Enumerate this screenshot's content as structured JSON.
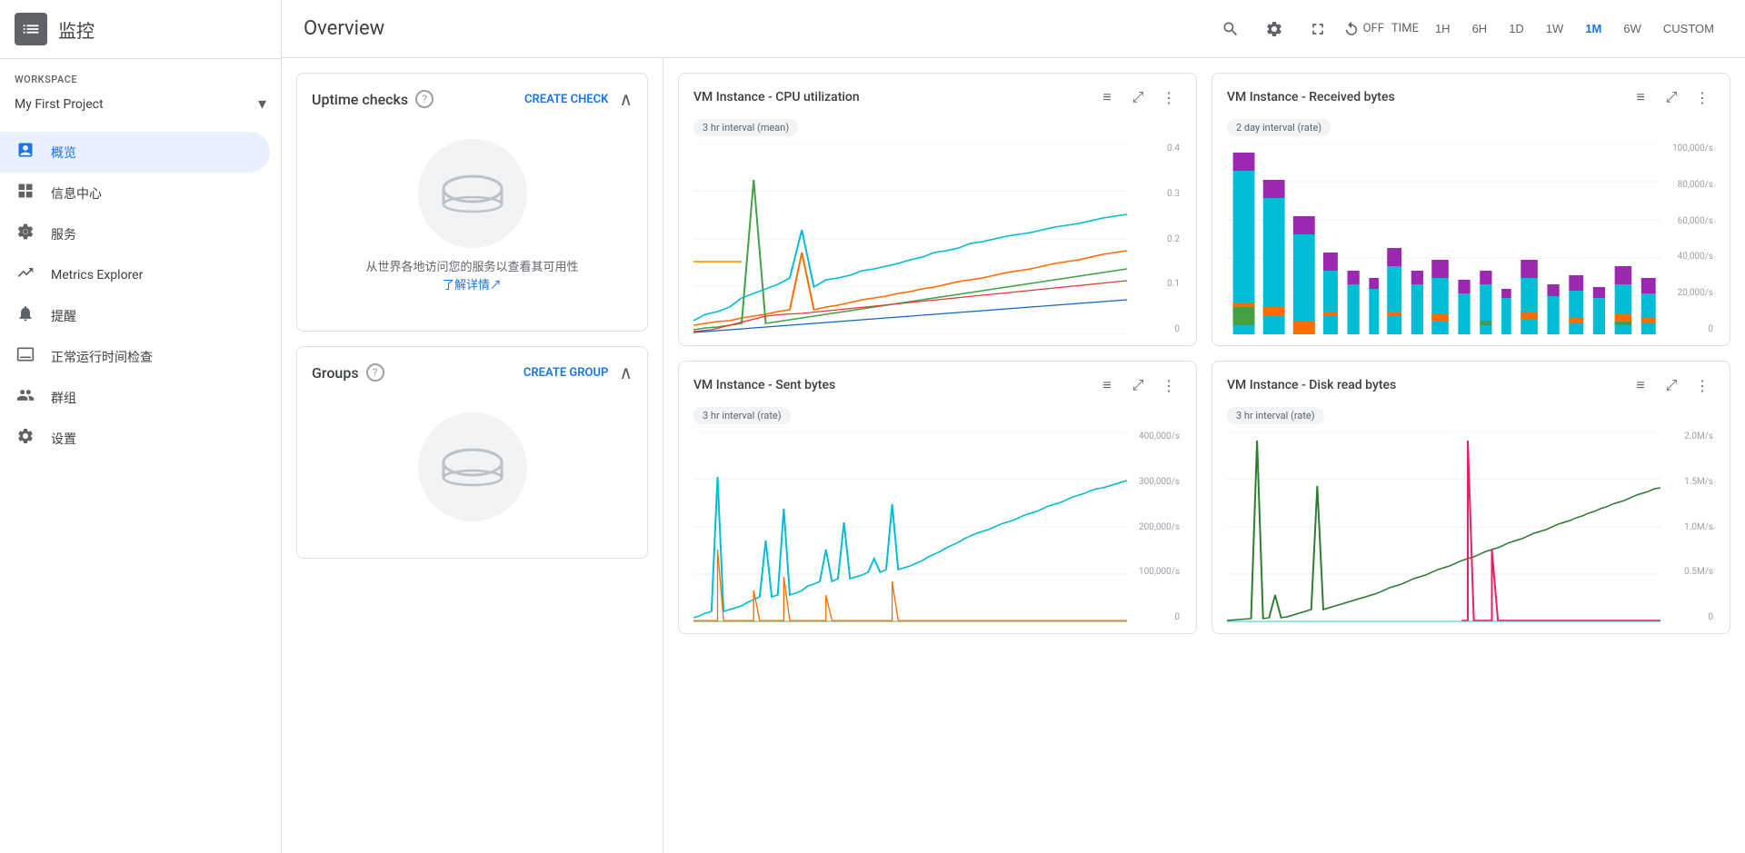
{
  "app": {
    "title": "监控",
    "logo_aria": "monitoring-logo"
  },
  "workspace": {
    "label": "Workspace",
    "project": "My First Project"
  },
  "nav": {
    "items": [
      {
        "id": "overview",
        "label": "概览",
        "icon": "📊",
        "active": true
      },
      {
        "id": "dashboard",
        "label": "信息中心",
        "icon": "⊞"
      },
      {
        "id": "services",
        "label": "服务",
        "icon": "⚙"
      },
      {
        "id": "metrics",
        "label": "Metrics Explorer",
        "icon": "📈"
      },
      {
        "id": "alerts",
        "label": "提醒",
        "icon": "🔔"
      },
      {
        "id": "uptime",
        "label": "正常运行时间检查",
        "icon": "🖥"
      },
      {
        "id": "groups",
        "label": "群组",
        "icon": "📋"
      },
      {
        "id": "settings",
        "label": "设置",
        "icon": "⚙"
      }
    ]
  },
  "topbar": {
    "page_title": "Overview",
    "refresh_label": "OFF",
    "time_label": "TIME",
    "time_options": [
      "1H",
      "6H",
      "1D",
      "1W",
      "1M",
      "6W",
      "CUSTOM"
    ],
    "active_time": "1M"
  },
  "uptime_card": {
    "title": "Uptime checks",
    "create_label": "CREATE CHECK",
    "empty_text": "从世界各地访问您的服务以查看其可用性",
    "learn_more": "了解详情↗"
  },
  "groups_card": {
    "title": "Groups",
    "create_label": "CREATE GROUP"
  },
  "charts": [
    {
      "id": "cpu",
      "title": "VM Instance - CPU utilization",
      "interval": "3 hr interval (mean)",
      "y_labels": [
        "0.4",
        "0.3",
        "0.2",
        "0.1",
        "0"
      ],
      "type": "line"
    },
    {
      "id": "received_bytes",
      "title": "VM Instance - Received bytes",
      "interval": "2 day interval (rate)",
      "y_labels": [
        "100,000/s",
        "80,000/s",
        "60,000/s",
        "40,000/s",
        "20,000/s",
        "0"
      ],
      "type": "bar"
    },
    {
      "id": "sent_bytes",
      "title": "VM Instance - Sent bytes",
      "interval": "3 hr interval (rate)",
      "y_labels": [
        "400,000/s",
        "300,000/s",
        "200,000/s",
        "100,000/s",
        "0"
      ],
      "type": "line"
    },
    {
      "id": "disk_read",
      "title": "VM Instance - Disk read bytes",
      "interval": "3 hr interval (rate)",
      "y_labels": [
        "2.0M/s",
        "1.5M/s",
        "1.0M/s",
        "0.5M/s",
        "0"
      ],
      "type": "line"
    }
  ]
}
